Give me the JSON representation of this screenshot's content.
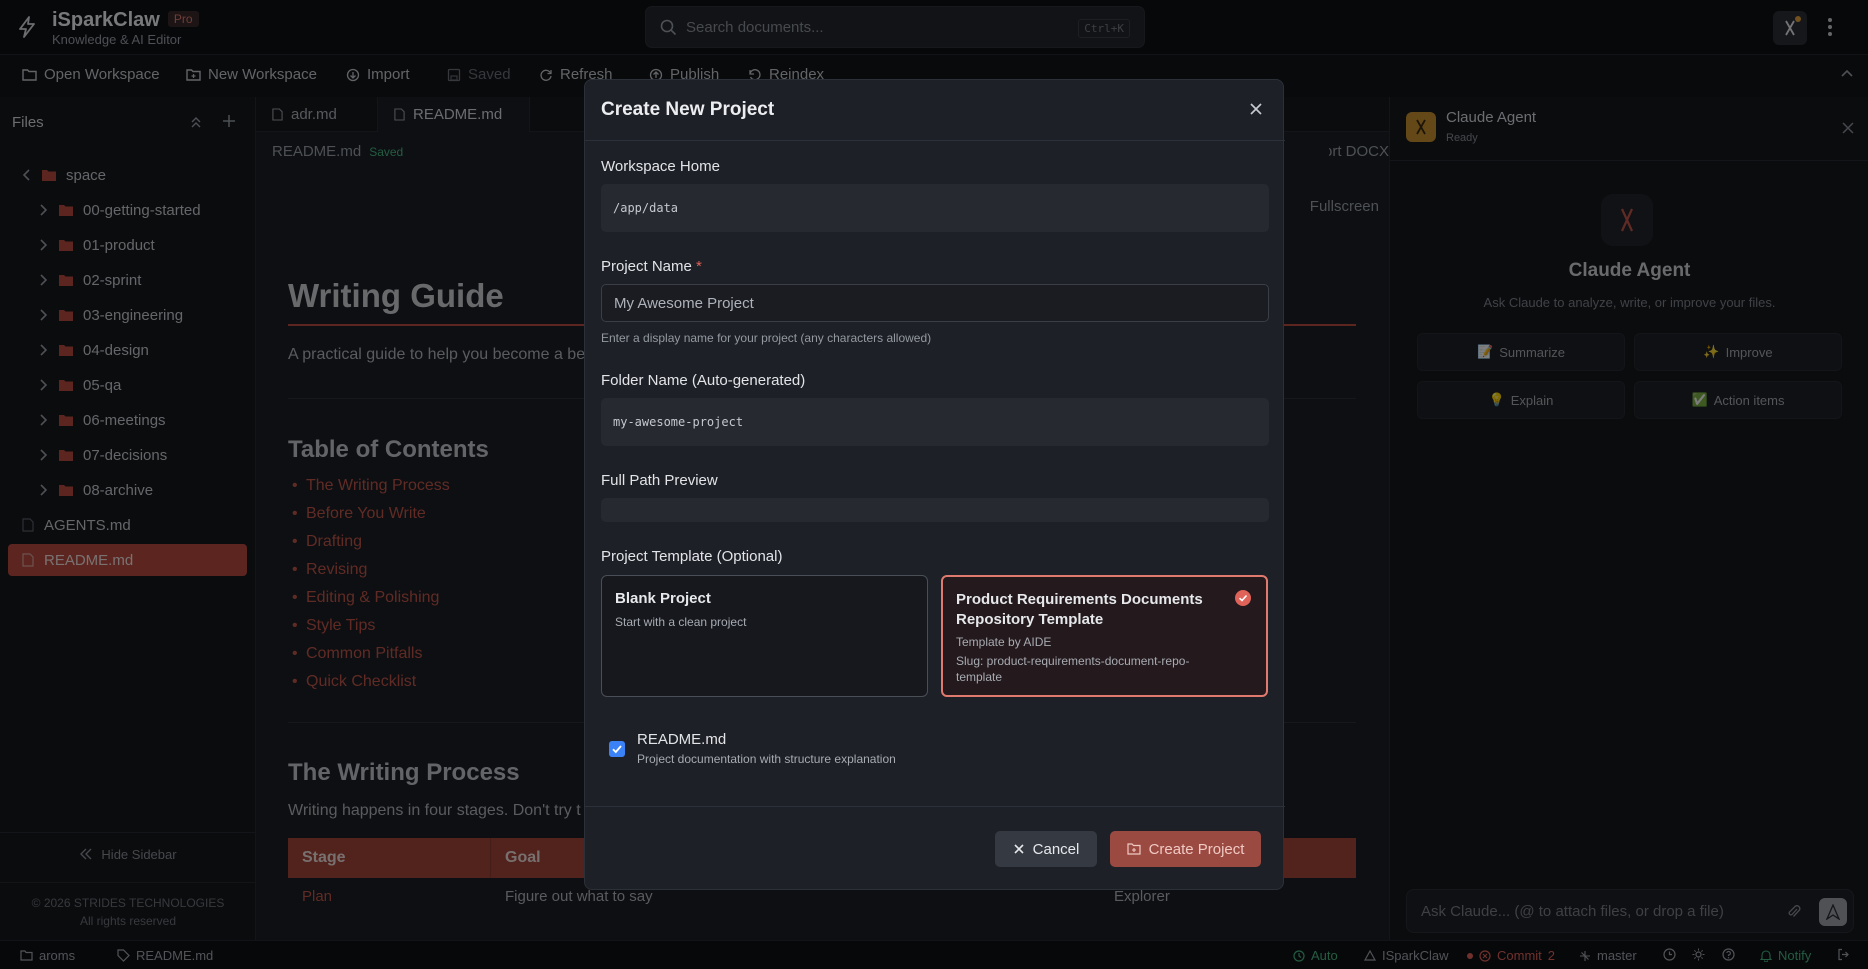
{
  "app": {
    "name": "iSparkClaw",
    "badge": "Pro",
    "subtitle": "Knowledge & AI Editor"
  },
  "search": {
    "placeholder": "Search documents...",
    "shortcut": "Ctrl+K"
  },
  "toolbar": {
    "open_workspace": "Open Workspace",
    "new_workspace": "New Workspace",
    "import": "Import",
    "saved": "Saved",
    "refresh": "Refresh",
    "publish": "Publish",
    "reindex": "Reindex"
  },
  "sidebar": {
    "title": "Files",
    "root": "space",
    "folders": [
      "00-getting-started",
      "01-product",
      "02-sprint",
      "03-engineering",
      "04-design",
      "05-qa",
      "06-meetings",
      "07-decisions",
      "08-archive"
    ],
    "files": [
      "AGENTS.md",
      "README.md"
    ],
    "hide": "Hide Sidebar",
    "copyright": "© 2026 STRIDES TECHNOLOGIES",
    "rights": "All rights reserved"
  },
  "editor": {
    "tabs": [
      "adr.md",
      "README.md"
    ],
    "breadcrumb": "README.md",
    "saved_badge": "Saved",
    "export": "Export DOCX",
    "fullscreen": "Fullscreen",
    "title": "Writing Guide",
    "intro": "A practical guide to help you become a be",
    "toc_heading": "Table of Contents",
    "toc": [
      "The Writing Process",
      "Before You Write",
      "Drafting",
      "Revising",
      "Editing & Polishing",
      "Style Tips",
      "Common Pitfalls",
      "Quick Checklist"
    ],
    "process_heading": "The Writing Process",
    "process_text": "Writing happens in four stages. Don't try t",
    "table_headers": [
      "Stage",
      "Goal"
    ],
    "table_row": [
      "Plan",
      "Figure out what to say",
      "Explorer"
    ]
  },
  "agent": {
    "name": "Claude Agent",
    "status": "Ready",
    "title": "Claude Agent",
    "desc": "Ask Claude to analyze, write, or improve your files.",
    "actions": [
      {
        "icon": "📝",
        "label": "Summarize"
      },
      {
        "icon": "✨",
        "label": "Improve"
      },
      {
        "icon": "💡",
        "label": "Explain"
      },
      {
        "icon": "✅",
        "label": "Action items"
      }
    ],
    "input_placeholder": "Ask Claude... (@ to attach files, or drop a file)"
  },
  "statusbar": {
    "workspace": "aroms",
    "file": "README.md",
    "auto": "Auto",
    "app": "ISparkClaw",
    "commit": "Commit",
    "commit_count": "2",
    "branch": "master",
    "notify": "Notify"
  },
  "modal": {
    "title": "Create New Project",
    "workspace_home_label": "Workspace Home",
    "workspace_home_value": "/app/data",
    "project_name_label": "Project Name",
    "required_mark": "*",
    "project_name_placeholder": "My Awesome Project",
    "project_name_help": "Enter a display name for your project (any characters allowed)",
    "folder_label": "Folder Name (Auto-generated)",
    "folder_value": "my-awesome-project",
    "full_path_label": "Full Path Preview",
    "template_label": "Project Template (Optional)",
    "templates": [
      {
        "title": "Blank Project",
        "desc": "Start with a clean project"
      },
      {
        "title": "Product Requirements Documents Repository Template",
        "by": "Template by AIDE",
        "slug": "Slug: product-requirements-document-repo-template"
      }
    ],
    "readme_label": "README.md",
    "readme_desc": "Project documentation with structure explanation",
    "readme_checked": true,
    "cancel": "Cancel",
    "create": "Create Project"
  },
  "colors": {
    "accent": "#b94a3e",
    "bg": "#1b1e24",
    "checkbox": "#3b82f6"
  }
}
